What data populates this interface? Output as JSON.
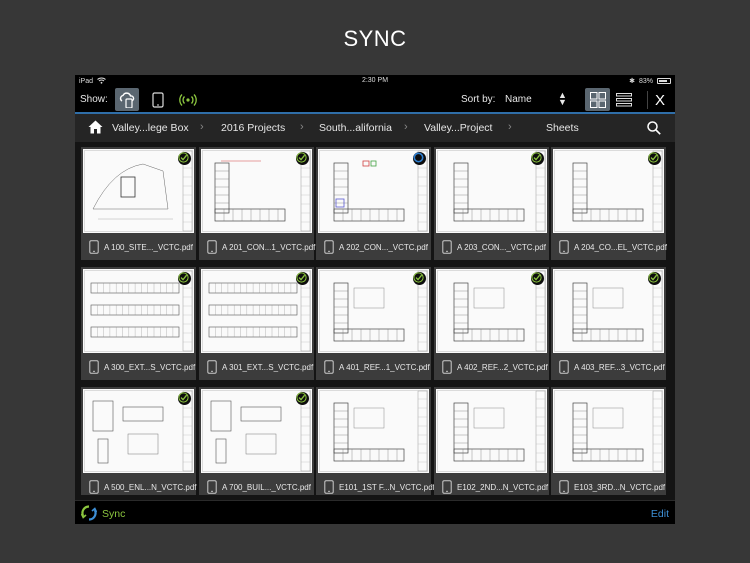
{
  "headline": "SYNC",
  "status": {
    "device": "iPad",
    "time": "2:30 PM",
    "battery": "83%",
    "battery_level": 0.83
  },
  "toolbar": {
    "show_label": "Show:",
    "sort_label": "Sort by:",
    "sort_value": "Name",
    "close_glyph": "X"
  },
  "breadcrumb": [
    "Valley...lege Box",
    "2016 Projects",
    "South...alifornia",
    "Valley...Project",
    "Sheets"
  ],
  "files": [
    {
      "name": "A 100_SITE..._VCTC.pdf",
      "status": "synced"
    },
    {
      "name": "A 201_CON...1_VCTC.pdf",
      "status": "synced"
    },
    {
      "name": "A 202_CON..._VCTC.pdf",
      "status": "syncing"
    },
    {
      "name": "A 203_CON..._VCTC.pdf",
      "status": "synced"
    },
    {
      "name": "A 204_CO...EL_VCTC.pdf",
      "status": "synced"
    },
    {
      "name": "A 300_EXT...S_VCTC.pdf",
      "status": "synced"
    },
    {
      "name": "A 301_EXT...S_VCTC.pdf",
      "status": "synced"
    },
    {
      "name": "A 401_REF...1_VCTC.pdf",
      "status": "synced"
    },
    {
      "name": "A 402_REF...2_VCTC.pdf",
      "status": "synced"
    },
    {
      "name": "A 403_REF...3_VCTC.pdf",
      "status": "synced"
    },
    {
      "name": "A 500_ENL...N_VCTC.pdf",
      "status": "synced"
    },
    {
      "name": "A 700_BUIL..._VCTC.pdf",
      "status": "synced"
    },
    {
      "name": "E101_1ST F...N_VCTC.pdf",
      "status": "none"
    },
    {
      "name": "E102_2ND...N_VCTC.pdf",
      "status": "none"
    },
    {
      "name": "E103_3RD...N_VCTC.pdf",
      "status": "none"
    }
  ],
  "bottom": {
    "sync_label": "Sync",
    "edit_label": "Edit"
  },
  "colors": {
    "accent_blue": "#3d8fd6",
    "sync_green": "#8cc63f",
    "badge_blue": "#2f7fd0"
  }
}
